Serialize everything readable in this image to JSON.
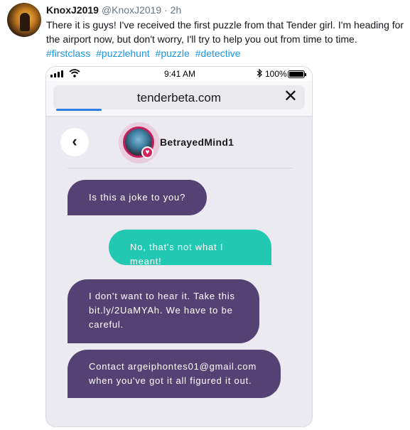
{
  "tweet": {
    "author_name": "KnoxJ2019",
    "author_handle": "@KnoxJ2019",
    "separator": "·",
    "time": "2h",
    "text": "There it is guys! I've received the first puzzle from that Tender girl. I'm heading for the airport now, but don't worry, I'll try to help you out from time to time.",
    "hashtags": [
      "#firstclass",
      "#puzzlehunt",
      "#puzzle",
      "#detective"
    ]
  },
  "phone": {
    "status": {
      "time": "9:41 AM",
      "battery": "100%",
      "wifi_icon": "wifi-icon",
      "bluetooth_icon": "bluetooth-icon"
    },
    "browser": {
      "url": "tenderbeta.com",
      "close_glyph": "✕",
      "load_progress": 0.18
    },
    "chat": {
      "back_glyph": "‹",
      "username": "BetrayedMind1",
      "messages": [
        {
          "direction": "incoming",
          "text": "Is this a joke to you?"
        },
        {
          "direction": "outgoing",
          "text": "No, that's not what I meant!"
        },
        {
          "direction": "incoming",
          "text": "I don't want to hear it. Take this bit.ly/2UaMYAh. We have to be careful."
        },
        {
          "direction": "incoming",
          "text": "Contact argeiphontes01@gmail.com when you've got it all figured it out."
        }
      ]
    }
  },
  "colors": {
    "incoming_bubble": "#544274",
    "outgoing_bubble": "#21c8b2",
    "hashtag": "#1b95e0",
    "heart_badge": "#d3245f"
  }
}
